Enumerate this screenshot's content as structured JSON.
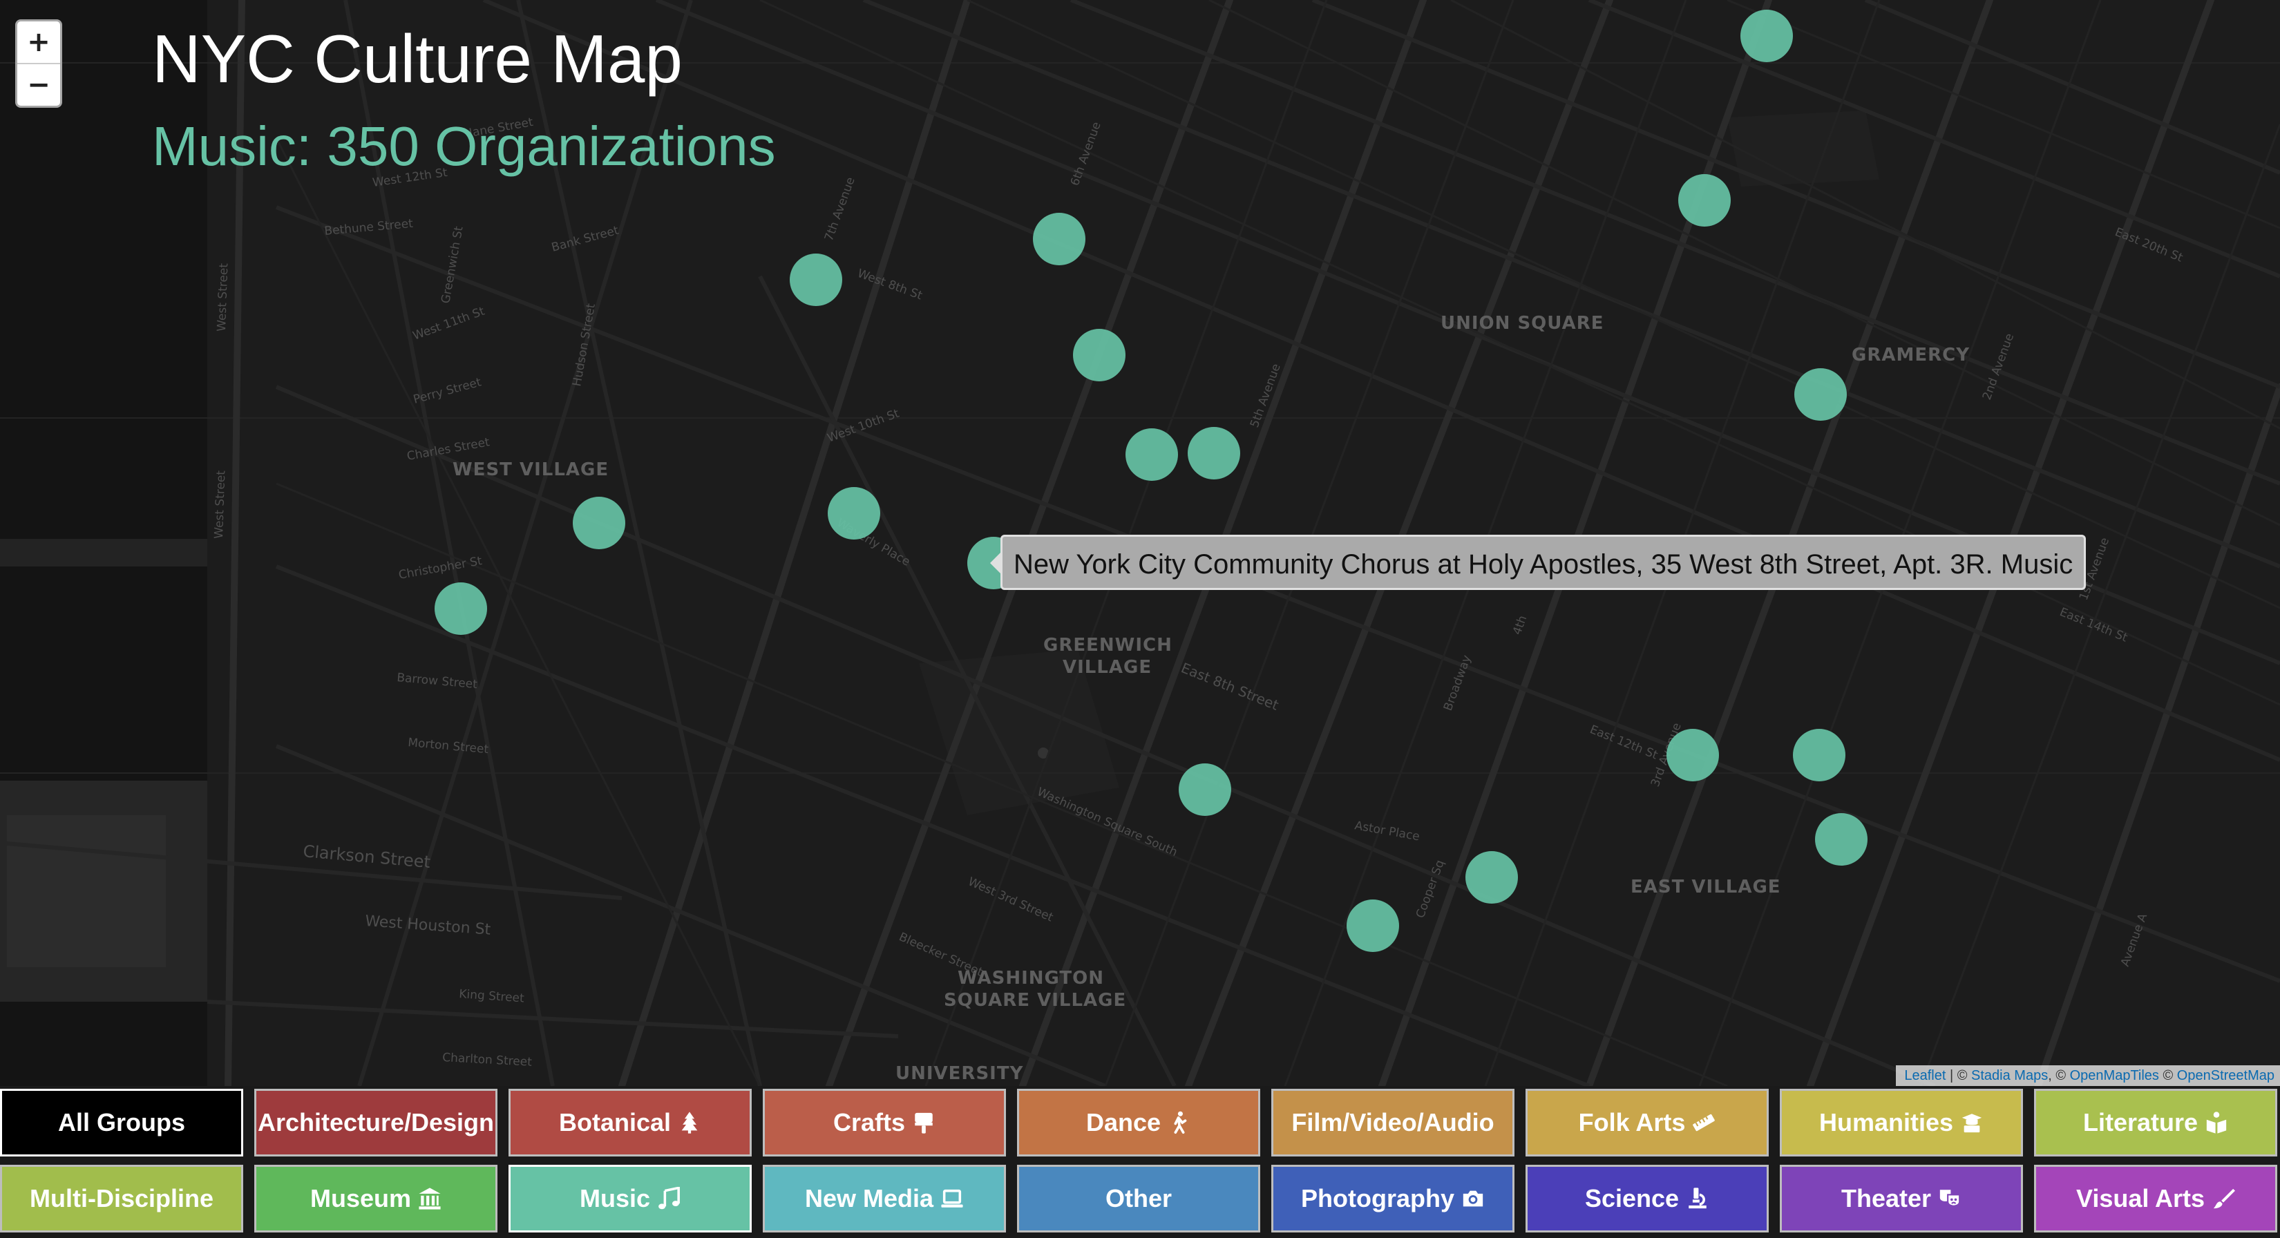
{
  "map": {
    "title": "NYC Culture Map",
    "subtitle": "Music: 350 Organizations",
    "marker_color": "#66c2a5",
    "zoom_in_label": "+",
    "zoom_out_label": "−",
    "tooltip": "New York City Community Chorus at Holy Apostles, 35 West 8th Street, Apt. 3R. Music",
    "attribution": {
      "leaflet": "Leaflet",
      "sep1": " | © ",
      "stadia": "Stadia Maps",
      "sep2": ", © ",
      "openmaptiles": "OpenMapTiles",
      "sep3": " © ",
      "openstreetmap": "OpenStreetMap"
    },
    "area_labels": {
      "union_square": "UNION SQUARE",
      "gramercy": "GRAMERCY",
      "west_village": "WEST VILLAGE",
      "greenwich_1": "GREENWICH",
      "greenwich_2": "VILLAGE",
      "east_village": "EAST VILLAGE",
      "washington_1": "WASHINGTON",
      "washington_2": "SQUARE VILLAGE",
      "university": "UNIVERSITY"
    },
    "street_labels": {
      "west_street": "West Street",
      "west_street_2": "West Street",
      "bethune": "Bethune Street",
      "bank": "Bank Street",
      "perry": "Perry Street",
      "charles": "Charles Street",
      "christopher": "Christopher St",
      "barrow": "Barrow Street",
      "morton": "Morton Street",
      "clarkson": "Clarkson Street",
      "west_houston": "West Houston St",
      "king": "King Street",
      "charlton": "Charlton Street",
      "jane": "Jane Street",
      "west_12th": "West 12th St",
      "west_11th": "West 11th St",
      "west_10th": "West 10th St",
      "west_8th": "West 8th St",
      "east_8th": "East 8th Street",
      "fifth_ave": "5th Avenue",
      "sixth_ave": "6th Avenue",
      "seventh_ave": "7th Avenue",
      "broadway": "Broadway",
      "third_ave": "3rd Avenue",
      "second_ave": "2nd Avenue",
      "first_ave": "1st Avenue",
      "east_14th": "East 14th St",
      "east_20th": "East 20th St",
      "ave_a": "Avenue A",
      "fourth": "4th",
      "bleecker": "Bleecker Street",
      "washington_sq": "Washington Square South",
      "west_3rd": "West 3rd Street",
      "astor": "Astor Place",
      "cooper": "Cooper Sq",
      "east_12th": "East 12th St",
      "waverly": "Waverly Place",
      "greenwich_st": "Greenwich St",
      "hudson": "Hudson Street"
    }
  },
  "filters": [
    {
      "label": "All Groups",
      "color": "#000000",
      "icon": ""
    },
    {
      "label": "Architecture/Design",
      "color": "#9e3b3d",
      "icon": ""
    },
    {
      "label": "Botanical",
      "color": "#b04b44",
      "icon": "tree-icon"
    },
    {
      "label": "Crafts",
      "color": "#bb5e4a",
      "icon": "paint-roller-icon"
    },
    {
      "label": "Dance",
      "color": "#c27445",
      "icon": "walking-figure-icon"
    },
    {
      "label": "Film/Video/Audio",
      "color": "#c4914a",
      "icon": ""
    },
    {
      "label": "Folk Arts",
      "color": "#c9a64b",
      "icon": "ruler-icon"
    },
    {
      "label": "Humanities",
      "color": "#c7bb4d",
      "icon": "graduation-cap-icon"
    },
    {
      "label": "Literature",
      "color": "#a9c04f",
      "icon": "book-reader-icon"
    },
    {
      "label": "Multi-Discipline",
      "color": "#a1bd4c",
      "icon": ""
    },
    {
      "label": "Museum",
      "color": "#5fb85b",
      "icon": "landmark-icon"
    },
    {
      "label": "Music",
      "color": "#66c2a5",
      "icon": "music-note-icon"
    },
    {
      "label": "New Media",
      "color": "#5fb8c0",
      "icon": "laptop-icon"
    },
    {
      "label": "Other",
      "color": "#4a88be",
      "icon": ""
    },
    {
      "label": "Photography",
      "color": "#3f60b8",
      "icon": "camera-icon"
    },
    {
      "label": "Science",
      "color": "#4b3fb8",
      "icon": "microscope-icon"
    },
    {
      "label": "Theater",
      "color": "#7e44b8",
      "icon": "theater-masks-icon"
    },
    {
      "label": "Visual Arts",
      "color": "#a445b9",
      "icon": "paintbrush-icon"
    }
  ]
}
